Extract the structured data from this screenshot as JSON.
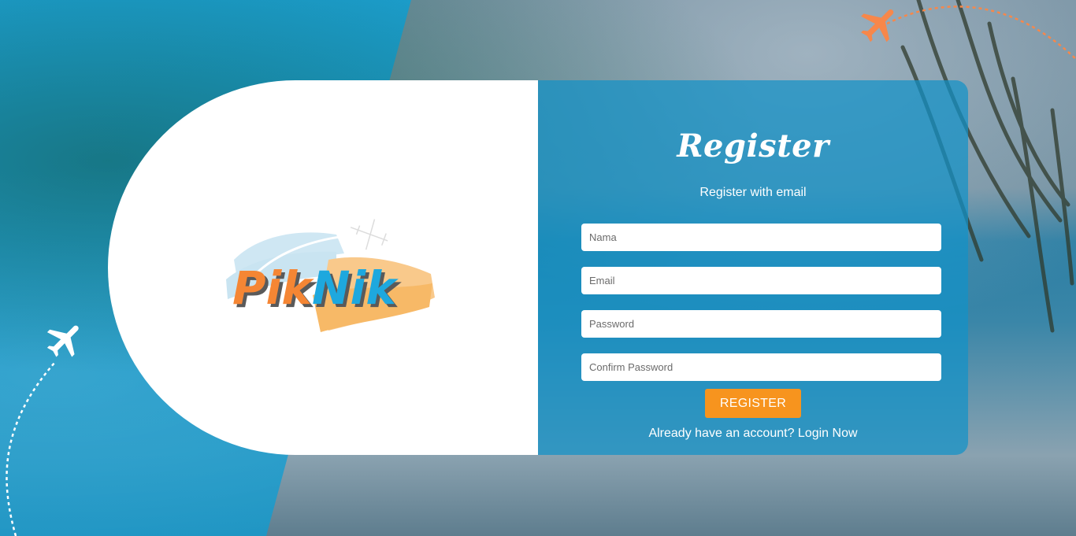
{
  "brand": {
    "logo_text": "PikNik",
    "colors": {
      "accent_orange": "#f7941e",
      "panel_blue": "#1291c8",
      "logo_blue": "#1ea8de"
    }
  },
  "form": {
    "title": "Register",
    "subtitle": "Register with email",
    "fields": {
      "name_placeholder": "Nama",
      "email_placeholder": "Email",
      "password_placeholder": "Password",
      "confirm_password_placeholder": "Confirm Password"
    },
    "register_label": "REGISTER",
    "login_prompt": "Already have an account?",
    "login_link": "Login Now"
  },
  "decor": {
    "icons": [
      "airplane-icon",
      "airplane-icon",
      "palm-leaves"
    ]
  }
}
